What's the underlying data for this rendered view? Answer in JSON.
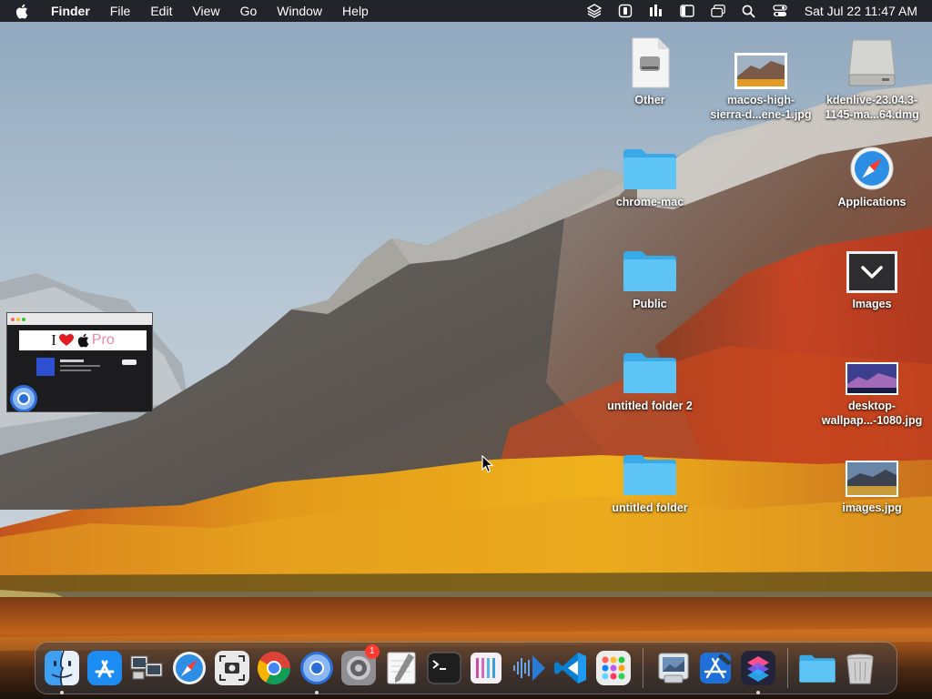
{
  "menubar": {
    "app_name": "Finder",
    "menus": [
      "File",
      "Edit",
      "View",
      "Go",
      "Window",
      "Help"
    ],
    "status_icons": [
      "layers-icon",
      "app-badge-icon",
      "audio-bars-icon",
      "sidebar-icon",
      "window-icon",
      "search-icon",
      "control-center-icon"
    ],
    "clock": "Sat Jul 22  11:47 AM"
  },
  "desktop": {
    "icons": [
      {
        "label": "Other",
        "icon": "drive-document-icon"
      },
      {
        "label": "macos-high-\nsierra-d...ene-1.jpg",
        "icon": "image-thumbnail-icon"
      },
      {
        "label": "kdenlive-23.04.3-\n1145-ma...64.dmg",
        "icon": "disk-image-icon"
      },
      {
        "label": "chrome-mac",
        "icon": "folder-icon"
      },
      {
        "label": "Applications",
        "icon": "safari-icon"
      },
      {
        "label": "Public",
        "icon": "folder-icon"
      },
      {
        "label": "Images",
        "icon": "chevron-down-icon"
      },
      {
        "label": "untitled folder 2",
        "icon": "folder-icon"
      },
      {
        "label": "desktop-\nwallpap...-1080.jpg",
        "icon": "image-thumbnail-icon"
      },
      {
        "label": "untitled folder",
        "icon": "folder-icon"
      },
      {
        "label": "images.jpg",
        "icon": "image-thumbnail-icon"
      }
    ]
  },
  "window_thumbnail": {
    "banner_text": "I",
    "banner_pro": "Pro"
  },
  "dock": {
    "items": [
      {
        "name": "finder",
        "running": true
      },
      {
        "name": "app-store",
        "running": false
      },
      {
        "name": "migration-assistant",
        "running": false
      },
      {
        "name": "safari",
        "running": false
      },
      {
        "name": "screenshot",
        "running": false
      },
      {
        "name": "chrome",
        "running": false
      },
      {
        "name": "chromium",
        "running": true
      },
      {
        "name": "system-settings",
        "running": false,
        "badge": "1"
      },
      {
        "name": "script-editor",
        "running": false
      },
      {
        "name": "terminal",
        "running": false
      },
      {
        "name": "columns-app",
        "running": false
      },
      {
        "name": "audio-app",
        "running": false
      },
      {
        "name": "vscode",
        "running": false
      },
      {
        "name": "launchpad",
        "running": false
      },
      {
        "name": "preview",
        "running": false
      },
      {
        "name": "xcode",
        "running": false
      },
      {
        "name": "shortcuts",
        "running": true
      },
      {
        "name": "downloads-folder",
        "running": false
      },
      {
        "name": "trash",
        "running": false
      }
    ]
  },
  "colors": {
    "folder_blue": "#5ec4f5",
    "menubar_bg": "#121214",
    "badge_red": "#ff3b30"
  }
}
